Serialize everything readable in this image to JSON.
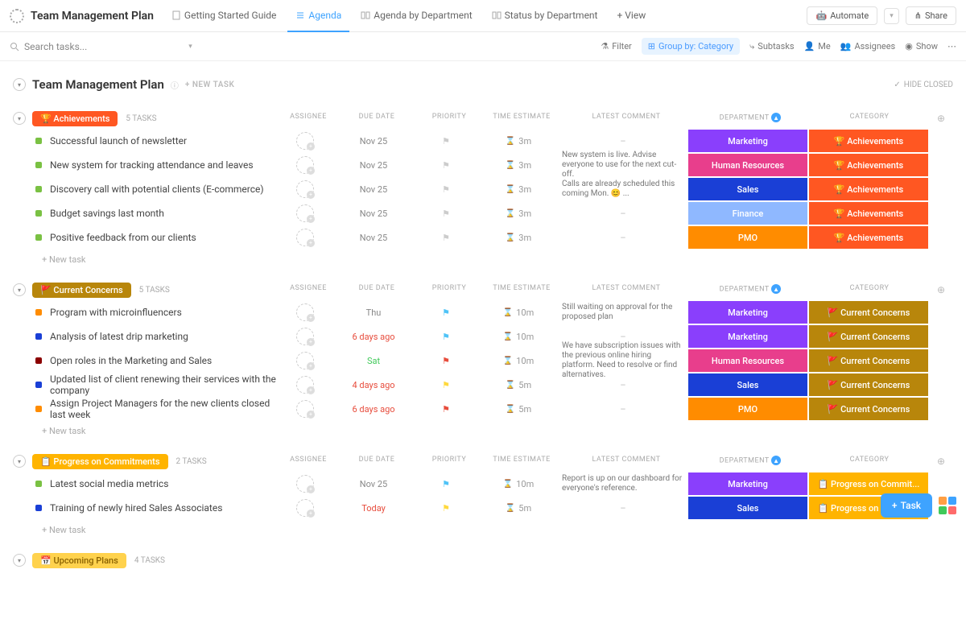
{
  "header": {
    "title": "Team Management Plan",
    "views": [
      {
        "label": "Getting Started Guide",
        "active": false
      },
      {
        "label": "Agenda",
        "active": true
      },
      {
        "label": "Agenda by Department",
        "active": false
      },
      {
        "label": "Status by Department",
        "active": false
      }
    ],
    "add_view": "+ View",
    "automate": "Automate",
    "share": "Share"
  },
  "subbar": {
    "search_placeholder": "Search tasks...",
    "filter": "Filter",
    "group_by": "Group by: Category",
    "subtasks": "Subtasks",
    "me": "Me",
    "assignees": "Assignees",
    "show": "Show"
  },
  "page": {
    "title": "Team Management Plan",
    "new_task": "+ NEW TASK",
    "hide_closed": "HIDE CLOSED"
  },
  "columns": {
    "assignee": "ASSIGNEE",
    "due_date": "DUE DATE",
    "priority": "PRIORITY",
    "time_est": "TIME ESTIMATE",
    "latest_comment": "LATEST COMMENT",
    "department": "DEPARTMENT",
    "category": "CATEGORY"
  },
  "new_task_row": "+ New task",
  "groups": [
    {
      "name": "Achievements",
      "pill_color": "#ff5722",
      "emoji": "🏆",
      "count": "5 TASKS",
      "tasks": [
        {
          "dot": "#7ac143",
          "title": "Successful launch of newsletter",
          "due": "Nov 25",
          "due_color": "#888",
          "flag": "#ccc",
          "time": "3m",
          "comment": "–",
          "dept": "Marketing",
          "dept_color": "#8a3ffc",
          "cat": "🏆 Achievements",
          "cat_color": "#ff5722"
        },
        {
          "dot": "#7ac143",
          "title": "New system for tracking attendance and leaves",
          "due": "Nov 25",
          "due_color": "#888",
          "flag": "#ccc",
          "time": "3m",
          "comment": "New system is live. Advise everyone to use for the next cut-off.",
          "dept": "Human Resources",
          "dept_color": "#e83e8c",
          "cat": "🏆 Achievements",
          "cat_color": "#ff5722"
        },
        {
          "dot": "#7ac143",
          "title": "Discovery call with potential clients (E-commerce)",
          "due": "Nov 25",
          "due_color": "#888",
          "flag": "#ccc",
          "time": "3m",
          "comment": "Calls are already scheduled this coming Mon. 😊 ...",
          "dept": "Sales",
          "dept_color": "#1a3fd6",
          "cat": "🏆 Achievements",
          "cat_color": "#ff5722"
        },
        {
          "dot": "#7ac143",
          "title": "Budget savings last month",
          "due": "Nov 25",
          "due_color": "#888",
          "flag": "#ccc",
          "time": "3m",
          "comment": "–",
          "dept": "Finance",
          "dept_color": "#8fb8ff",
          "cat": "🏆 Achievements",
          "cat_color": "#ff5722"
        },
        {
          "dot": "#7ac143",
          "title": "Positive feedback from our clients",
          "due": "Nov 25",
          "due_color": "#888",
          "flag": "#ccc",
          "time": "3m",
          "comment": "–",
          "dept": "PMO",
          "dept_color": "#ff8c00",
          "cat": "🏆 Achievements",
          "cat_color": "#ff5722"
        }
      ]
    },
    {
      "name": "Current Concerns",
      "pill_color": "#b8860b",
      "emoji": "🚩",
      "count": "5 TASKS",
      "tasks": [
        {
          "dot": "#ff8c00",
          "title": "Program with microinfluencers",
          "due": "Thu",
          "due_color": "#888",
          "flag": "#4fc3f7",
          "time": "10m",
          "comment": "Still waiting on approval for the proposed plan",
          "dept": "Marketing",
          "dept_color": "#8a3ffc",
          "cat": "🚩 Current Concerns",
          "cat_color": "#b8860b"
        },
        {
          "dot": "#1a3fd6",
          "title": "Analysis of latest drip marketing",
          "due": "6 days ago",
          "due_color": "#e74c3c",
          "flag": "#4fc3f7",
          "time": "10m",
          "comment": "–",
          "dept": "Marketing",
          "dept_color": "#8a3ffc",
          "cat": "🚩 Current Concerns",
          "cat_color": "#b8860b"
        },
        {
          "dot": "#8b0000",
          "title": "Open roles in the Marketing and Sales",
          "due": "Sat",
          "due_color": "#40c95a",
          "flag": "#e74c3c",
          "time": "10m",
          "comment": "We have subscription issues with the previous online hiring platform. Need to resolve or find alternatives.",
          "dept": "Human Resources",
          "dept_color": "#e83e8c",
          "cat": "🚩 Current Concerns",
          "cat_color": "#b8860b"
        },
        {
          "dot": "#1a3fd6",
          "title": "Updated list of client renewing their services with the company",
          "due": "4 days ago",
          "due_color": "#e74c3c",
          "flag": "#ffd93d",
          "time": "5m",
          "comment": "–",
          "dept": "Sales",
          "dept_color": "#1a3fd6",
          "cat": "🚩 Current Concerns",
          "cat_color": "#b8860b"
        },
        {
          "dot": "#ff8c00",
          "title": "Assign Project Managers for the new clients closed last week",
          "due": "6 days ago",
          "due_color": "#e74c3c",
          "flag": "#e74c3c",
          "time": "5m",
          "comment": "–",
          "dept": "PMO",
          "dept_color": "#ff8c00",
          "cat": "🚩 Current Concerns",
          "cat_color": "#b8860b"
        }
      ]
    },
    {
      "name": "Progress on Commitments",
      "pill_color": "#ffb400",
      "emoji": "📋",
      "count": "2 TASKS",
      "tasks": [
        {
          "dot": "#7ac143",
          "title": "Latest social media metrics",
          "due": "Nov 25",
          "due_color": "#888",
          "flag": "#4fc3f7",
          "time": "10m",
          "comment": "Report is up on our dashboard for everyone's reference.",
          "dept": "Marketing",
          "dept_color": "#8a3ffc",
          "cat": "📋 Progress on Commit...",
          "cat_color": "#ffb400"
        },
        {
          "dot": "#1a3fd6",
          "title": "Training of newly hired Sales Associates",
          "due": "Today",
          "due_color": "#e74c3c",
          "flag": "#ffd93d",
          "time": "5m",
          "comment": "–",
          "dept": "Sales",
          "dept_color": "#1a3fd6",
          "cat": "📋 Progress on Commit...",
          "cat_color": "#ffb400"
        }
      ]
    }
  ],
  "upcoming": {
    "label": "Upcoming Plans",
    "count_label": "4 TASKS"
  },
  "fab": {
    "task": "Task"
  }
}
